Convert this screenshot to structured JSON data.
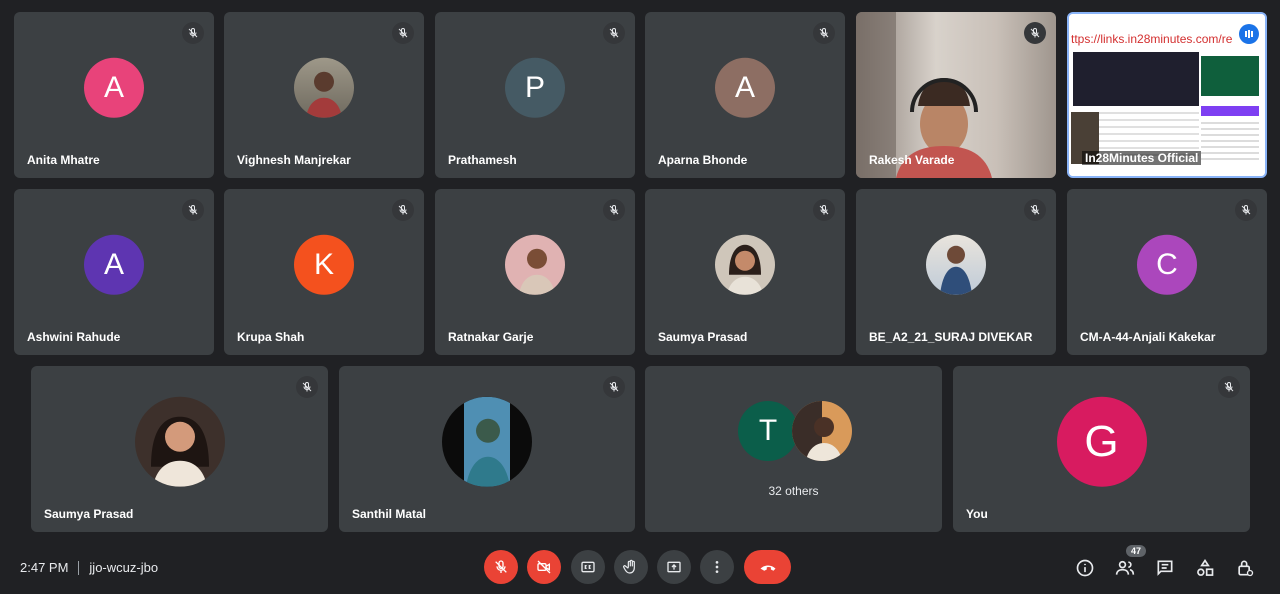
{
  "participants_row1": [
    {
      "name": "Anita Mhatre",
      "initial": "A",
      "color": "#e8437a"
    },
    {
      "name": "Vighnesh Manjrekar",
      "initial": "",
      "color": "#8d8a7e"
    },
    {
      "name": "Prathamesh",
      "initial": "P",
      "color": "#455a64"
    },
    {
      "name": "Aparna Bhonde",
      "initial": "A",
      "color": "#8d6e63"
    },
    {
      "name": "Rakesh Varade",
      "initial": "",
      "color": ""
    },
    {
      "name": "In28Minutes Official",
      "initial": "",
      "color": ""
    }
  ],
  "participants_row2": [
    {
      "name": "Ashwini Rahude",
      "initial": "A",
      "color": "#5e35b1"
    },
    {
      "name": "Krupa Shah",
      "initial": "K",
      "color": "#f4511e"
    },
    {
      "name": "Ratnakar Garje",
      "initial": "",
      "color": "#d7a8a8"
    },
    {
      "name": "Saumya Prasad",
      "initial": "",
      "color": "#b0a79a"
    },
    {
      "name": "BE_A2_21_SURAJ DIVEKAR",
      "initial": "",
      "color": "#6d8fb5"
    },
    {
      "name": "CM-A-44-Anjali Kakekar",
      "initial": "C",
      "color": "#ab47bc"
    }
  ],
  "participants_row3": [
    {
      "name": "Saumya Prasad",
      "initial": "",
      "color": "#6d5b52"
    },
    {
      "name": "Santhil Matal",
      "initial": "",
      "color": "#3b6f8f"
    },
    {
      "name": "",
      "initial": "T",
      "color": "#0b5e4a"
    },
    {
      "name": "You",
      "initial": "G",
      "color": "#d81b60"
    }
  ],
  "others_label": "32 others",
  "screen_share_url": "ttps://links.in28minutes.com/re",
  "meeting": {
    "time": "2:47 PM",
    "code": "jjo-wcuz-jbo"
  },
  "people_count": "47",
  "icons": {
    "mute": "mic-off-icon",
    "camera": "videocam-off-icon",
    "captions": "closed-captions-icon",
    "hand": "raise-hand-icon",
    "present": "present-screen-icon",
    "more": "more-vert-icon",
    "leave": "call-end-icon",
    "info": "info-icon",
    "people": "people-icon",
    "chat": "chat-icon",
    "activities": "activities-icon",
    "lock": "host-controls-icon"
  },
  "colors": {
    "danger": "#ea4335",
    "tile": "#3c4043",
    "bg": "#202124",
    "active_border": "#8ab4f8"
  }
}
